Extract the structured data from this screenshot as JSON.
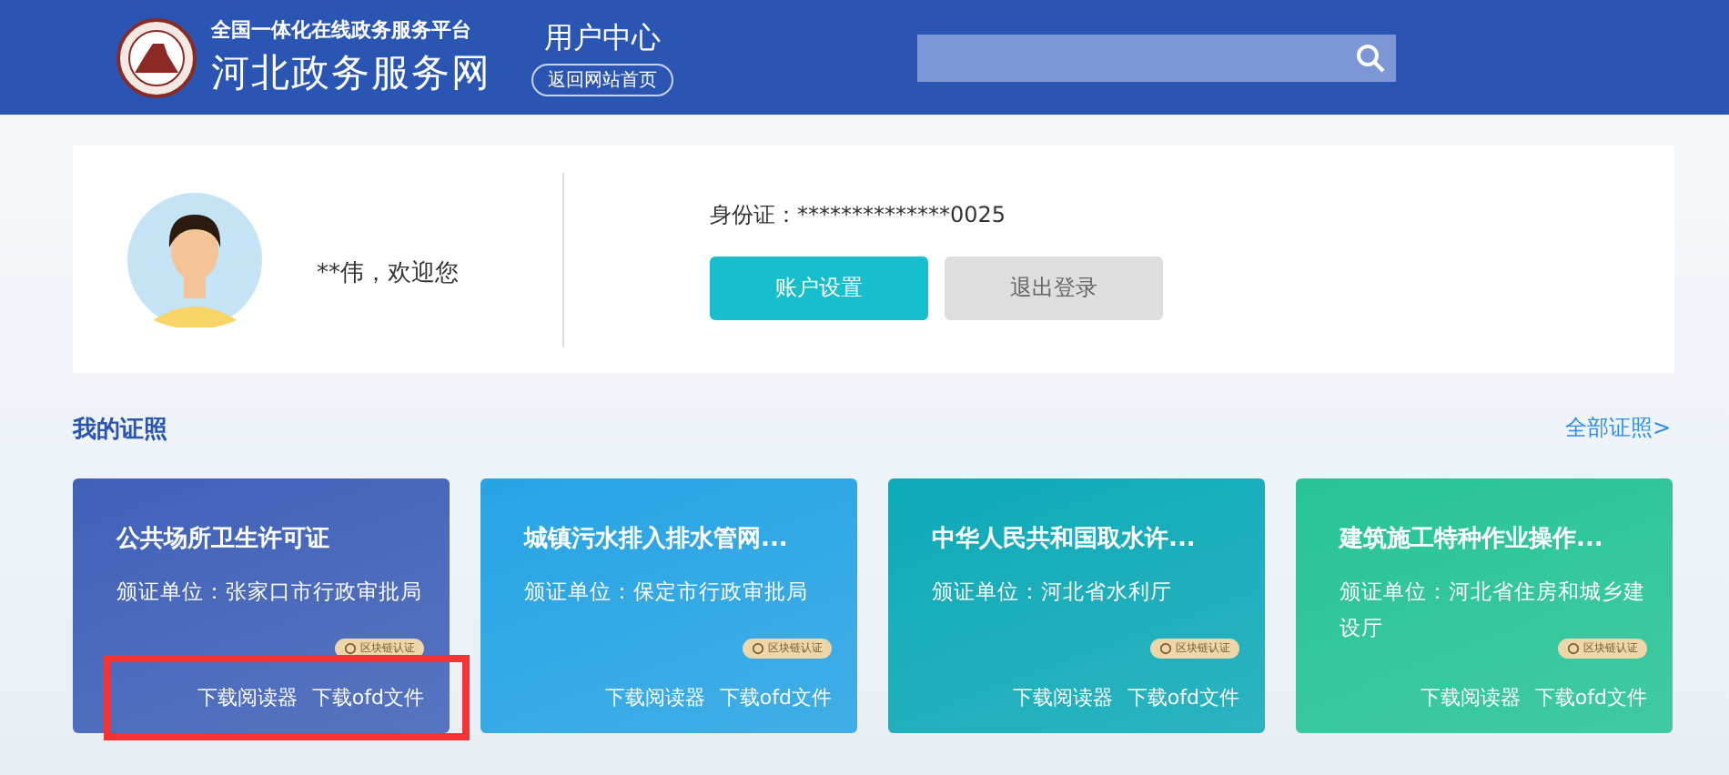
{
  "header": {
    "tagline": "全国一体化在线政务服务平台",
    "site_name": "河北政务服务网",
    "section_title": "用户中心",
    "home_link": "返回网站首页"
  },
  "profile": {
    "greeting": "**伟，欢迎您",
    "id_label": "身份证：",
    "id_value": "**************0025",
    "buttons": [
      {
        "label": "账户设置",
        "kind": "primary"
      },
      {
        "label": "退出登录",
        "kind": "secondary"
      }
    ]
  },
  "licenses": {
    "title": "我的证照",
    "all_link": "全部证照>",
    "cards": [
      {
        "title": "公共场所卫生许可证",
        "issuer": "颁证单位：张家口市行政审批局",
        "badge": "区块链认证",
        "color": "#4061b8",
        "highlighted": true,
        "links": [
          "下载阅读器",
          "下载ofd文件"
        ]
      },
      {
        "title": "城镇污水排入排水管网...",
        "issuer": "颁证单位：保定市行政审批局",
        "badge": "区块链认证",
        "color": "#27a4e4",
        "highlighted": false,
        "links": [
          "下载阅读器",
          "下载ofd文件"
        ]
      },
      {
        "title": "中华人民共和国取水许...",
        "issuer": "颁证单位：河北省水利厅",
        "badge": "区块链认证",
        "color": "#0eaab8",
        "highlighted": false,
        "links": [
          "下载阅读器",
          "下载ofd文件"
        ]
      },
      {
        "title": "建筑施工特种作业操作...",
        "issuer": "颁证单位：河北省住房和城乡建设厅",
        "badge": "区块链认证",
        "color": "#27c496",
        "highlighted": false,
        "links": [
          "下载阅读器",
          "下载ofd文件"
        ]
      }
    ]
  }
}
